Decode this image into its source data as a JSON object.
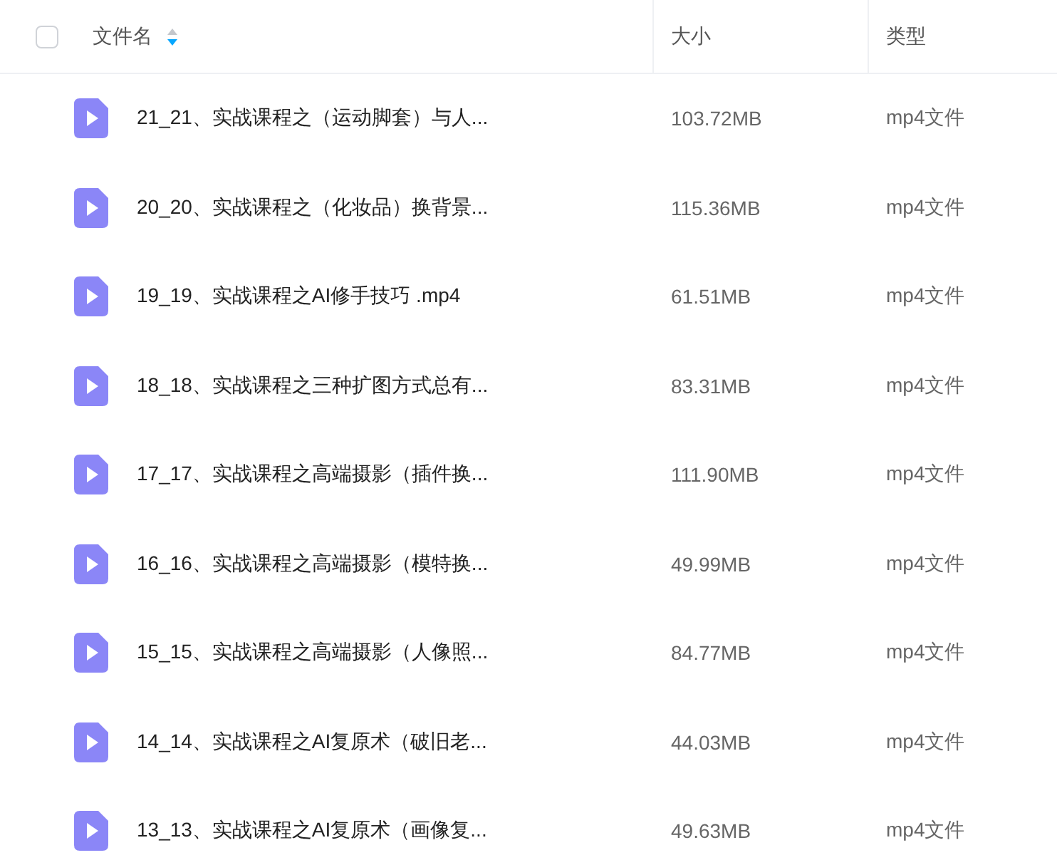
{
  "header": {
    "select_all": {
      "checked": false
    },
    "columns": [
      {
        "label": "文件名",
        "sorted": true
      },
      {
        "label": "大小",
        "sorted": false
      },
      {
        "label": "类型",
        "sorted": false
      }
    ]
  },
  "rows": [
    {
      "name": "21_21、实战课程之（运动脚套）与人...",
      "size": "103.72MB",
      "type": "mp4文件"
    },
    {
      "name": "20_20、实战课程之（化妆品）换背景...",
      "size": "115.36MB",
      "type": "mp4文件"
    },
    {
      "name": "19_19、实战课程之AI修手技巧 .mp4",
      "size": "61.51MB",
      "type": "mp4文件"
    },
    {
      "name": "18_18、实战课程之三种扩图方式总有...",
      "size": "83.31MB",
      "type": "mp4文件"
    },
    {
      "name": "17_17、实战课程之高端摄影（插件换...",
      "size": "111.90MB",
      "type": "mp4文件"
    },
    {
      "name": "16_16、实战课程之高端摄影（模特换...",
      "size": "49.99MB",
      "type": "mp4文件"
    },
    {
      "name": "15_15、实战课程之高端摄影（人像照...",
      "size": "84.77MB",
      "type": "mp4文件"
    },
    {
      "name": "14_14、实战课程之AI复原术（破旧老...",
      "size": "44.03MB",
      "type": "mp4文件"
    },
    {
      "name": "13_13、实战课程之AI复原术（画像复...",
      "size": "49.63MB",
      "type": "mp4文件"
    }
  ]
}
